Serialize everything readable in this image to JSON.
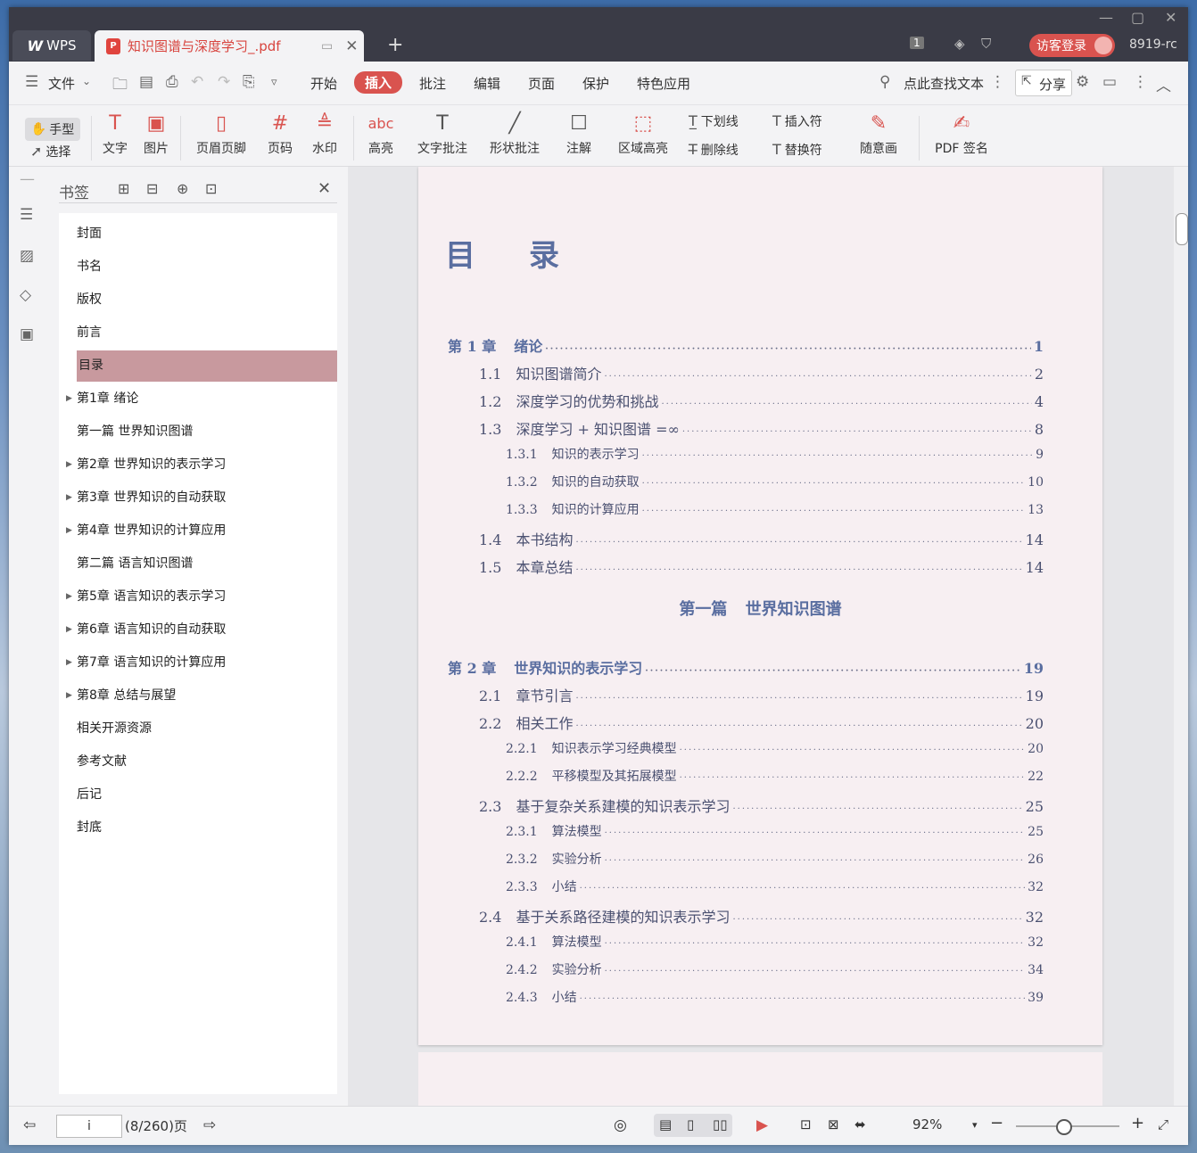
{
  "titlebar": {
    "app_tab": "WPS",
    "doc_tab": "知识图谱与深度学习_.pdf",
    "login": "访客登录",
    "user_id": "8919-rc",
    "page_badge": "1"
  },
  "menu": {
    "file": "文件",
    "items": [
      "开始",
      "插入",
      "批注",
      "编辑",
      "页面",
      "保护",
      "特色应用"
    ],
    "active": "插入",
    "search": "点此查找文本",
    "share": "分享"
  },
  "ribbon": {
    "hand": "手型",
    "select": "选择",
    "text": "文字",
    "image": "图片",
    "header_footer": "页眉页脚",
    "page_number": "页码",
    "watermark": "水印",
    "highlight": "高亮",
    "text_comment": "文字批注",
    "shape_comment": "形状批注",
    "note": "注解",
    "area_highlight": "区域高亮",
    "underline": "下划线",
    "strikethrough": "删除线",
    "insert_mark": "插入符",
    "replace_mark": "替换符",
    "freehand": "随意画",
    "pdf_sign": "PDF 签名"
  },
  "bookmarks": {
    "title": "书签",
    "items": [
      {
        "label": "封面",
        "expandable": false
      },
      {
        "label": "书名",
        "expandable": false
      },
      {
        "label": "版权",
        "expandable": false
      },
      {
        "label": "前言",
        "expandable": false
      },
      {
        "label": "目录",
        "expandable": false,
        "selected": true
      },
      {
        "label": "第1章 绪论",
        "expandable": true
      },
      {
        "label": "第一篇 世界知识图谱",
        "expandable": false
      },
      {
        "label": "第2章 世界知识的表示学习",
        "expandable": true
      },
      {
        "label": "第3章 世界知识的自动获取",
        "expandable": true
      },
      {
        "label": "第4章 世界知识的计算应用",
        "expandable": true
      },
      {
        "label": "第二篇 语言知识图谱",
        "expandable": false
      },
      {
        "label": "第5章 语言知识的表示学习",
        "expandable": true
      },
      {
        "label": "第6章 语言知识的自动获取",
        "expandable": true
      },
      {
        "label": "第7章 语言知识的计算应用",
        "expandable": true
      },
      {
        "label": "第8章 总结与展望",
        "expandable": true
      },
      {
        "label": "相关开源资源",
        "expandable": false
      },
      {
        "label": "参考文献",
        "expandable": false
      },
      {
        "label": "后记",
        "expandable": false
      },
      {
        "label": "封底",
        "expandable": false
      }
    ]
  },
  "toc": {
    "title": "目录",
    "part1": "第一篇 世界知识图谱",
    "entries": [
      {
        "level": 0,
        "num": "第 1 章",
        "title": "绪论",
        "page": "1"
      },
      {
        "level": 1,
        "num": "1.1",
        "title": "知识图谱简介",
        "page": "2"
      },
      {
        "level": 1,
        "num": "1.2",
        "title": "深度学习的优势和挑战",
        "page": "4"
      },
      {
        "level": 1,
        "num": "1.3",
        "title": "深度学习 + 知识图谱 =∞",
        "page": "8"
      },
      {
        "level": 2,
        "num": "1.3.1",
        "title": "知识的表示学习",
        "page": "9"
      },
      {
        "level": 2,
        "num": "1.3.2",
        "title": "知识的自动获取",
        "page": "10"
      },
      {
        "level": 2,
        "num": "1.3.3",
        "title": "知识的计算应用",
        "page": "13"
      },
      {
        "level": 1,
        "num": "1.4",
        "title": "本书结构",
        "page": "14"
      },
      {
        "level": 1,
        "num": "1.5",
        "title": "本章总结",
        "page": "14"
      },
      {
        "level": 0,
        "num": "第 2 章",
        "title": "世界知识的表示学习",
        "page": "19"
      },
      {
        "level": 1,
        "num": "2.1",
        "title": "章节引言",
        "page": "19"
      },
      {
        "level": 1,
        "num": "2.2",
        "title": "相关工作",
        "page": "20"
      },
      {
        "level": 2,
        "num": "2.2.1",
        "title": "知识表示学习经典模型",
        "page": "20"
      },
      {
        "level": 2,
        "num": "2.2.2",
        "title": "平移模型及其拓展模型",
        "page": "22"
      },
      {
        "level": 1,
        "num": "2.3",
        "title": "基于复杂关系建模的知识表示学习",
        "page": "25"
      },
      {
        "level": 2,
        "num": "2.3.1",
        "title": "算法模型",
        "page": "25"
      },
      {
        "level": 2,
        "num": "2.3.2",
        "title": "实验分析",
        "page": "26"
      },
      {
        "level": 2,
        "num": "2.3.3",
        "title": "小结",
        "page": "32"
      },
      {
        "level": 1,
        "num": "2.4",
        "title": "基于关系路径建模的知识表示学习",
        "page": "32"
      },
      {
        "level": 2,
        "num": "2.4.1",
        "title": "算法模型",
        "page": "32"
      },
      {
        "level": 2,
        "num": "2.4.2",
        "title": "实验分析",
        "page": "34"
      },
      {
        "level": 2,
        "num": "2.4.3",
        "title": "小结",
        "page": "39"
      }
    ]
  },
  "status": {
    "page_input": "i",
    "page_info": "(8/260)页",
    "zoom": "92%",
    "zoom_level": 0.45
  }
}
